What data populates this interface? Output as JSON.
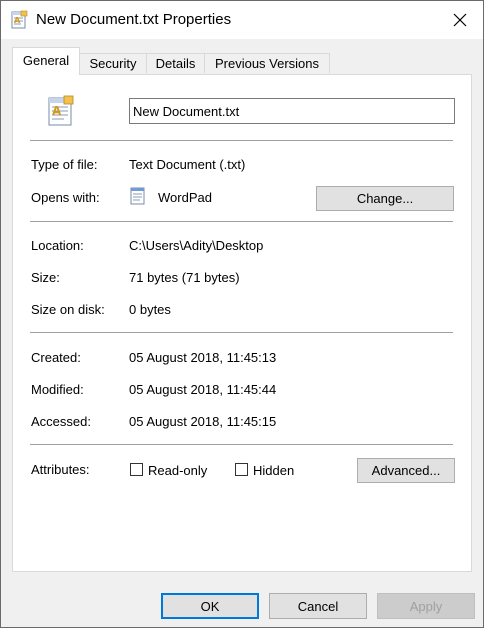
{
  "window": {
    "title": "New Document.txt Properties",
    "title_icon": "text-document-icon",
    "close_icon": "close-icon"
  },
  "tabs": [
    {
      "label": "General",
      "active": true
    },
    {
      "label": "Security",
      "active": false
    },
    {
      "label": "Details",
      "active": false
    },
    {
      "label": "Previous Versions",
      "active": false
    }
  ],
  "general": {
    "file_name": "New Document.txt",
    "file_icon": "text-document-icon",
    "type_label": "Type of file:",
    "type_value": "Text Document (.txt)",
    "opens_label": "Opens with:",
    "opens_value": "WordPad",
    "opens_icon": "wordpad-icon",
    "change_label": "Change...",
    "location_label": "Location:",
    "location_value": "C:\\Users\\Adity\\Desktop",
    "size_label": "Size:",
    "size_value": "71 bytes (71 bytes)",
    "disk_label": "Size on disk:",
    "disk_value": "0 bytes",
    "created_label": "Created:",
    "created_value": "05 August 2018, 11:45:13",
    "modified_label": "Modified:",
    "modified_value": "05 August 2018, 11:45:44",
    "accessed_label": "Accessed:",
    "accessed_value": "05 August 2018, 11:45:15",
    "attributes_label": "Attributes:",
    "readonly_label": "Read-only",
    "readonly_checked": false,
    "hidden_label": "Hidden",
    "hidden_checked": false,
    "advanced_label": "Advanced..."
  },
  "footer": {
    "ok_label": "OK",
    "cancel_label": "Cancel",
    "apply_label": "Apply"
  },
  "colors": {
    "accent": "#0078d7",
    "disabled_text": "#a0a0a0"
  }
}
